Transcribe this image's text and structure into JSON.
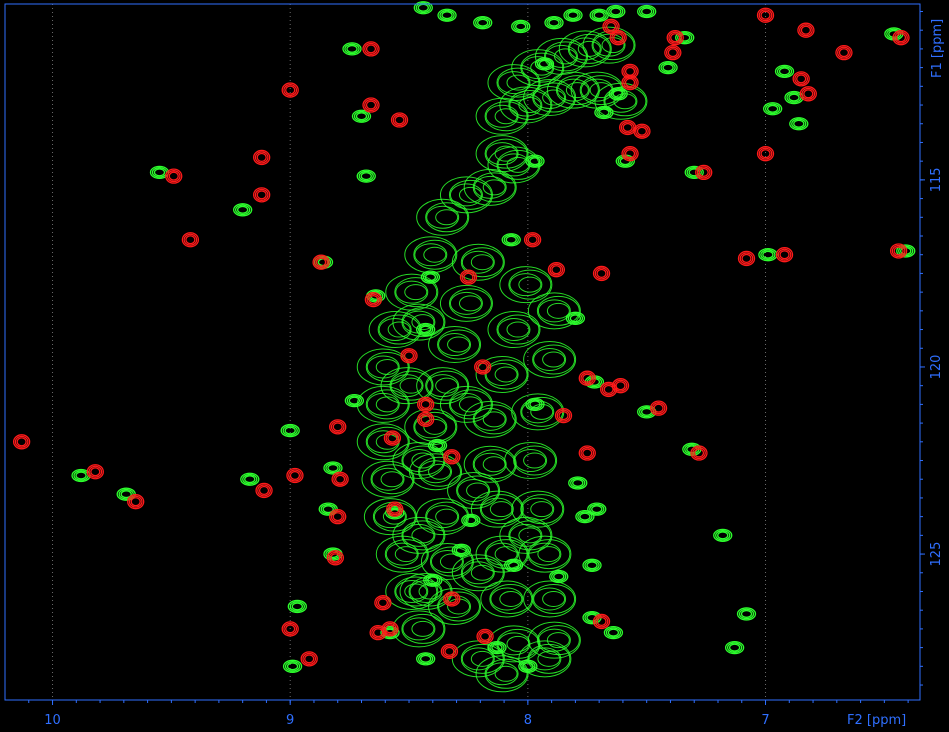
{
  "chart_data": {
    "type": "scatter",
    "title": "",
    "xlabel": "F2 [ppm]",
    "ylabel": "F1 [ppm]",
    "xlim": [
      10.2,
      6.35
    ],
    "ylim": [
      110.3,
      128.9
    ],
    "x_ticks": [
      10,
      9,
      8,
      7
    ],
    "x_tick_labels": [
      "10",
      "9",
      "8",
      "7"
    ],
    "y_ticks": [
      115,
      120,
      125
    ],
    "y_tick_labels": [
      "115",
      "120",
      "125"
    ],
    "grid": "vertical dotted at x ticks",
    "background": "#000000",
    "axis_color": "#2f6fff",
    "series": [
      {
        "color": "#ff1a1a",
        "style": "peak contours",
        "points": [
          [
            10.13,
            122.0
          ],
          [
            9.82,
            122.8
          ],
          [
            9.65,
            123.6
          ],
          [
            9.49,
            114.9
          ],
          [
            9.42,
            116.6
          ],
          [
            9.12,
            114.4
          ],
          [
            9.11,
            123.3
          ],
          [
            9.12,
            115.4
          ],
          [
            9.0,
            112.6
          ],
          [
            8.98,
            122.9
          ],
          [
            9.0,
            127.0
          ],
          [
            8.92,
            127.8
          ],
          [
            8.87,
            117.2
          ],
          [
            8.8,
            121.6
          ],
          [
            8.79,
            123.0
          ],
          [
            8.8,
            124.0
          ],
          [
            8.81,
            125.1
          ],
          [
            8.66,
            111.5
          ],
          [
            8.66,
            113.0
          ],
          [
            8.65,
            118.2
          ],
          [
            8.56,
            123.8
          ],
          [
            8.54,
            113.4
          ],
          [
            8.61,
            126.3
          ],
          [
            8.63,
            127.1
          ],
          [
            8.58,
            127.0
          ],
          [
            8.57,
            121.9
          ],
          [
            8.5,
            119.7
          ],
          [
            8.43,
            121.0
          ],
          [
            8.43,
            121.4
          ],
          [
            8.32,
            122.4
          ],
          [
            8.32,
            126.2
          ],
          [
            8.33,
            127.6
          ],
          [
            8.25,
            117.6
          ],
          [
            8.19,
            120.0
          ],
          [
            8.18,
            127.2
          ],
          [
            7.98,
            116.6
          ],
          [
            7.88,
            117.4
          ],
          [
            7.85,
            121.3
          ],
          [
            7.75,
            120.3
          ],
          [
            7.75,
            122.3
          ],
          [
            7.69,
            117.5
          ],
          [
            7.66,
            120.6
          ],
          [
            7.61,
            120.5
          ],
          [
            7.69,
            126.8
          ],
          [
            7.57,
            112.1
          ],
          [
            7.58,
            113.6
          ],
          [
            7.52,
            113.7
          ],
          [
            7.57,
            114.3
          ],
          [
            7.57,
            112.4
          ],
          [
            7.65,
            110.9
          ],
          [
            7.62,
            111.2
          ],
          [
            7.45,
            121.1
          ],
          [
            7.38,
            111.2
          ],
          [
            7.39,
            111.6
          ],
          [
            7.28,
            122.3
          ],
          [
            7.26,
            114.8
          ],
          [
            7.08,
            117.1
          ],
          [
            7.0,
            114.3
          ],
          [
            7.0,
            110.6
          ],
          [
            6.92,
            117.0
          ],
          [
            6.85,
            112.3
          ],
          [
            6.82,
            112.7
          ],
          [
            6.83,
            111.0
          ],
          [
            6.67,
            111.6
          ],
          [
            6.44,
            116.9
          ],
          [
            6.43,
            111.2
          ]
        ]
      },
      {
        "color": "#2dff2d",
        "style": "peak contours",
        "points": [
          [
            9.88,
            122.9
          ],
          [
            9.69,
            123.4
          ],
          [
            9.55,
            114.8
          ],
          [
            9.2,
            115.8
          ],
          [
            9.17,
            123.0
          ],
          [
            9.0,
            121.7
          ],
          [
            8.97,
            126.4
          ],
          [
            8.99,
            128.0
          ],
          [
            8.86,
            117.2
          ],
          [
            8.82,
            122.7
          ],
          [
            8.82,
            125.0
          ],
          [
            8.84,
            123.8
          ],
          [
            8.74,
            111.5
          ],
          [
            8.7,
            113.3
          ],
          [
            8.68,
            114.9
          ],
          [
            8.73,
            120.9
          ],
          [
            8.64,
            118.1
          ],
          [
            8.58,
            127.1
          ],
          [
            8.43,
            119.0
          ],
          [
            8.38,
            122.1
          ],
          [
            8.41,
            117.6
          ],
          [
            8.28,
            124.9
          ],
          [
            8.13,
            127.5
          ],
          [
            8.07,
            116.6
          ],
          [
            8.0,
            128.0
          ],
          [
            7.97,
            121.0
          ],
          [
            7.97,
            114.5
          ],
          [
            7.93,
            111.9
          ],
          [
            7.8,
            118.7
          ],
          [
            7.73,
            126.7
          ],
          [
            7.72,
            120.4
          ],
          [
            7.5,
            121.2
          ],
          [
            7.31,
            122.2
          ],
          [
            7.3,
            114.8
          ],
          [
            7.18,
            124.5
          ],
          [
            7.08,
            126.6
          ],
          [
            7.13,
            127.5
          ],
          [
            6.99,
            117.0
          ],
          [
            6.88,
            112.8
          ],
          [
            6.86,
            113.5
          ],
          [
            6.97,
            113.1
          ],
          [
            6.92,
            112.1
          ],
          [
            6.41,
            116.9
          ],
          [
            6.46,
            111.1
          ],
          [
            8.44,
            110.4
          ],
          [
            8.34,
            110.6
          ],
          [
            8.19,
            110.8
          ],
          [
            8.03,
            110.9
          ],
          [
            7.89,
            110.8
          ],
          [
            7.81,
            110.6
          ],
          [
            7.7,
            110.6
          ],
          [
            7.63,
            110.5
          ],
          [
            7.62,
            112.7
          ],
          [
            7.68,
            113.2
          ],
          [
            7.41,
            112.0
          ],
          [
            7.34,
            111.2
          ],
          [
            7.59,
            114.5
          ],
          [
            7.5,
            110.5
          ],
          [
            8.43,
            127.8
          ],
          [
            8.56,
            123.9
          ],
          [
            8.24,
            124.1
          ],
          [
            8.06,
            125.3
          ],
          [
            7.87,
            125.6
          ],
          [
            7.73,
            125.3
          ],
          [
            7.76,
            124.0
          ],
          [
            7.71,
            123.8
          ],
          [
            7.79,
            123.1
          ],
          [
            7.64,
            127.1
          ],
          [
            8.4,
            125.7
          ]
        ]
      }
    ],
    "overlap_ridge": [
      [
        8.05,
        112.4
      ],
      [
        7.95,
        112.0
      ],
      [
        7.85,
        111.7
      ],
      [
        7.75,
        111.5
      ],
      [
        7.65,
        111.4
      ],
      [
        8.1,
        113.3
      ],
      [
        8.0,
        113.0
      ],
      [
        7.9,
        112.8
      ],
      [
        7.8,
        112.6
      ],
      [
        7.7,
        112.6
      ],
      [
        7.6,
        112.9
      ],
      [
        8.1,
        114.3
      ],
      [
        8.05,
        114.6
      ],
      [
        8.15,
        115.2
      ],
      [
        8.25,
        115.4
      ],
      [
        8.35,
        116.0
      ],
      [
        8.4,
        117.0
      ],
      [
        8.48,
        118.0
      ],
      [
        8.55,
        119.0
      ],
      [
        8.6,
        120.0
      ],
      [
        8.6,
        121.0
      ],
      [
        8.6,
        122.0
      ],
      [
        8.58,
        123.0
      ],
      [
        8.57,
        124.0
      ],
      [
        8.52,
        125.0
      ],
      [
        8.48,
        126.0
      ],
      [
        8.45,
        127.0
      ],
      [
        8.2,
        117.2
      ],
      [
        8.25,
        118.3
      ],
      [
        8.3,
        119.4
      ],
      [
        8.35,
        120.5
      ],
      [
        8.4,
        121.6
      ],
      [
        8.38,
        122.8
      ],
      [
        8.35,
        124.0
      ],
      [
        8.33,
        125.2
      ],
      [
        8.3,
        126.4
      ],
      [
        8.0,
        117.8
      ],
      [
        8.05,
        119.0
      ],
      [
        8.1,
        120.2
      ],
      [
        8.15,
        121.4
      ],
      [
        8.15,
        122.6
      ],
      [
        8.12,
        123.8
      ],
      [
        8.1,
        125.0
      ],
      [
        8.08,
        126.2
      ],
      [
        8.05,
        127.4
      ],
      [
        7.88,
        118.5
      ],
      [
        7.9,
        119.8
      ],
      [
        7.95,
        121.2
      ],
      [
        7.98,
        122.5
      ],
      [
        7.95,
        123.8
      ],
      [
        7.92,
        125.0
      ],
      [
        7.9,
        126.2
      ],
      [
        7.88,
        127.3
      ],
      [
        8.45,
        118.8
      ],
      [
        8.5,
        120.5
      ],
      [
        8.45,
        122.5
      ],
      [
        8.45,
        124.5
      ],
      [
        8.42,
        126.0
      ],
      [
        8.25,
        121.0
      ],
      [
        8.22,
        123.3
      ],
      [
        8.2,
        125.5
      ],
      [
        8.0,
        124.5
      ],
      [
        8.2,
        127.8
      ],
      [
        8.1,
        128.2
      ],
      [
        7.92,
        127.8
      ]
    ]
  }
}
